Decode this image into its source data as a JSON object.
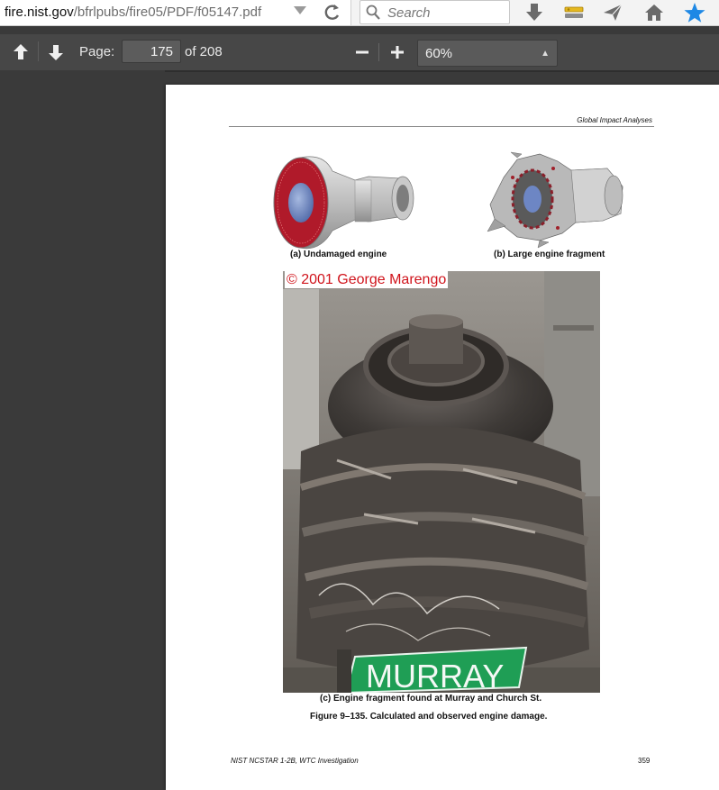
{
  "browser": {
    "url_host": "fire.nist.gov",
    "url_path": "/bfrlpubs/fire05/PDF/f05147.pdf",
    "search_placeholder": "Search"
  },
  "pdf_toolbar": {
    "page_label": "Page:",
    "current_page": "175",
    "page_count": "of 208",
    "zoom_value": "60%"
  },
  "document": {
    "header": "Global Impact Analyses",
    "caption_a": "(a) Undamaged engine",
    "caption_b": "(b) Large engine fragment",
    "photo_credit": "© 2001 George Marengo",
    "street_sign": "MURRAY",
    "caption_c": "(c) Engine fragment found at Murray and Church St.",
    "figure_caption": "Figure 9–135.  Calculated and observed engine damage.",
    "footer_left": "NIST NCSTAR 1-2B, WTC Investigation",
    "footer_page": "359"
  },
  "icons": {
    "dropdown": "chevron-down-icon",
    "reload": "reload-icon",
    "search": "search-icon",
    "download": "download-icon",
    "key": "key-icon",
    "send": "send-icon",
    "home": "home-icon",
    "bookmark": "star-icon",
    "prev_page": "arrow-up-icon",
    "next_page": "arrow-down-icon",
    "zoom_out": "minus-icon",
    "zoom_in": "plus-icon"
  },
  "colors": {
    "star": "#1e88e5",
    "credit": "#d0141c",
    "sign_green": "#1f9e55"
  }
}
